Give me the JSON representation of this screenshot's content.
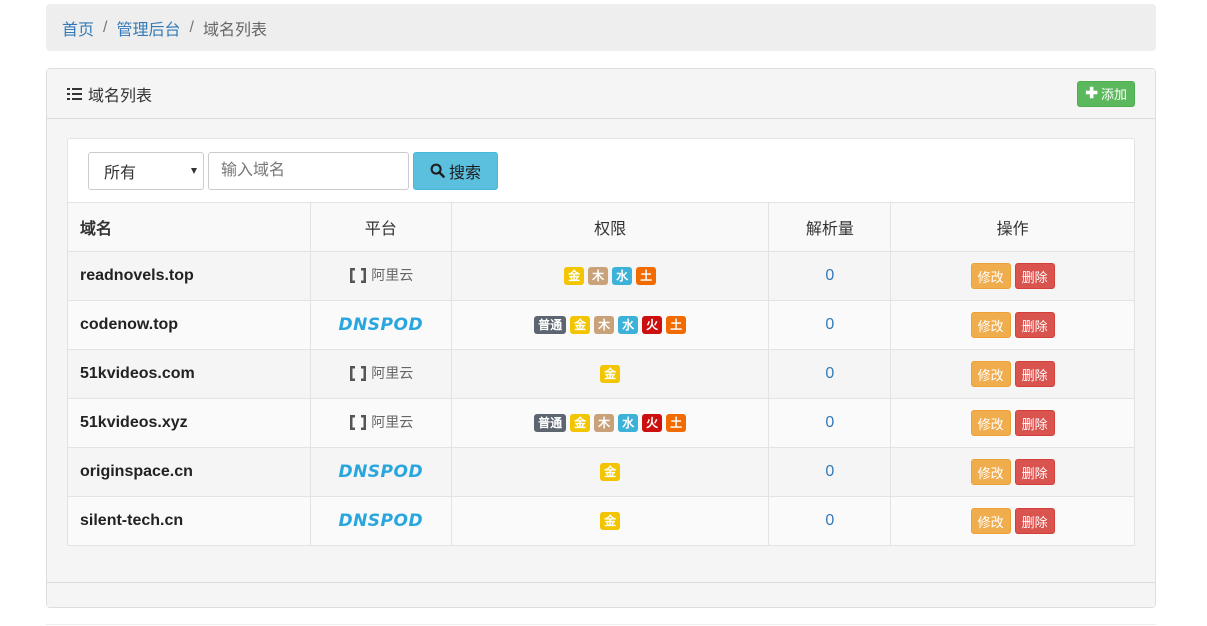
{
  "breadcrumb": {
    "home": "首页",
    "admin": "管理后台",
    "current": "域名列表",
    "separator": "/"
  },
  "panel": {
    "title": "域名列表",
    "add_label": "添加"
  },
  "search": {
    "filter_value": "所有",
    "input_placeholder": "输入域名",
    "button_label": "搜索"
  },
  "table": {
    "headers": [
      "域名",
      "平台",
      "权限",
      "解析量",
      "操作"
    ],
    "edit_label": "修改",
    "delete_label": "删除",
    "rows": [
      {
        "domain": "readnovels.top",
        "platform": "阿里云",
        "platform_type": "aliyun",
        "permissions": [
          "金",
          "木",
          "水",
          "土"
        ],
        "count": "0"
      },
      {
        "domain": "codenow.top",
        "platform": "DNSPOD",
        "platform_type": "dnspod",
        "permissions": [
          "普通",
          "金",
          "木",
          "水",
          "火",
          "土"
        ],
        "count": "0"
      },
      {
        "domain": "51kvideos.com",
        "platform": "阿里云",
        "platform_type": "aliyun",
        "permissions": [
          "金"
        ],
        "count": "0"
      },
      {
        "domain": "51kvideos.xyz",
        "platform": "阿里云",
        "platform_type": "aliyun",
        "permissions": [
          "普通",
          "金",
          "木",
          "水",
          "火",
          "土"
        ],
        "count": "0"
      },
      {
        "domain": "originspace.cn",
        "platform": "DNSPOD",
        "platform_type": "dnspod",
        "permissions": [
          "金"
        ],
        "count": "0"
      },
      {
        "domain": "silent-tech.cn",
        "platform": "DNSPOD",
        "platform_type": "dnspod",
        "permissions": [
          "金"
        ],
        "count": "0"
      }
    ]
  },
  "permission_colors": {
    "普通": "#5d6670",
    "金": "#f2c500",
    "木": "#c9a27a",
    "水": "#3cb2d9",
    "火": "#cc1010",
    "土": "#f26b00"
  }
}
